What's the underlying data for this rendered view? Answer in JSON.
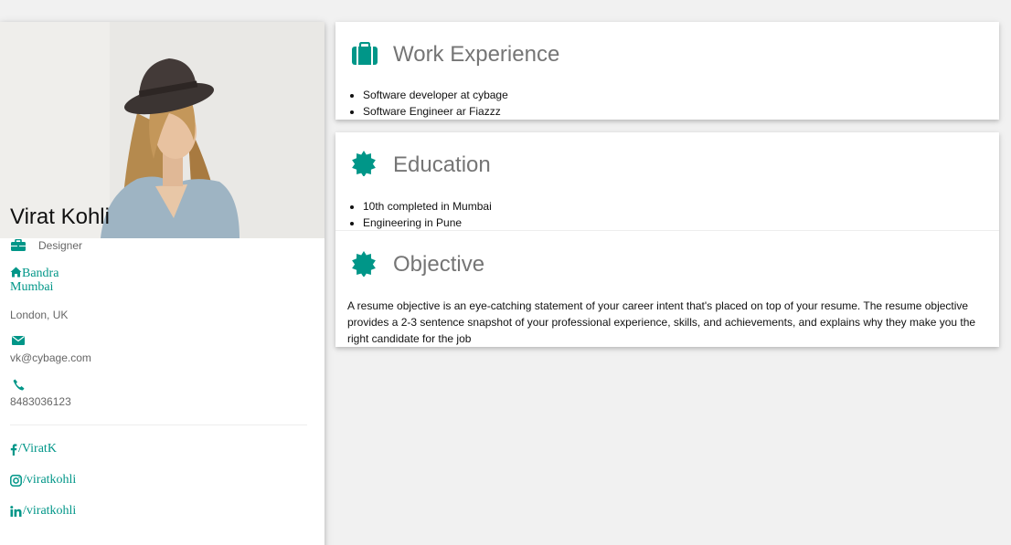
{
  "profile": {
    "name": "Virat Kohli",
    "job_title": "Designer",
    "address_line1": "Bandra",
    "address_line2": "Mumbai",
    "location": "London, UK",
    "email": "vk@cybage.com",
    "phone": "8483036123",
    "social": {
      "facebook": "/ViratK",
      "instagram": "/viratkohli",
      "linkedin": "/viratkohli"
    }
  },
  "work": {
    "title": "Work Experience",
    "items": [
      "Software developer at cybage",
      "Software Engineer ar Fiazzz"
    ]
  },
  "education": {
    "title": "Education",
    "items": [
      "10th completed in Mumbai",
      "Engineering in Pune"
    ]
  },
  "objective": {
    "title": "Objective",
    "text": "A resume objective is an eye-catching statement of your career intent that's placed on top of your resume. The resume objective provides a 2-3 sentence snapshot of your professional experience, skills, and achievements, and explains why they make you the right candidate for the job"
  },
  "icons": {
    "job": "briefcase-icon",
    "home": "home-icon",
    "email": "envelope-icon",
    "phone": "phone-icon",
    "facebook": "facebook-icon",
    "instagram": "instagram-icon",
    "linkedin": "linkedin-icon",
    "work": "suitcase-icon",
    "education": "certificate-icon",
    "objective": "certificate-icon"
  },
  "colors": {
    "accent": "#009688",
    "background": "#f1f1f1",
    "title_gray": "#757575"
  }
}
